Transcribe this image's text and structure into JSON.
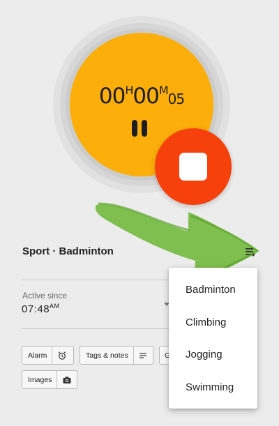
{
  "timer": {
    "hours": "00",
    "hours_unit": "H",
    "minutes": "00",
    "minutes_unit": "M",
    "seconds": "05"
  },
  "section": {
    "title": "Sport · Badminton"
  },
  "active": {
    "label": "Active since",
    "time": "07:48",
    "ampm": "AM"
  },
  "chips": {
    "alarm": "Alarm",
    "tags": "Tags & notes",
    "partial": "G",
    "images": "Images"
  },
  "menu": {
    "items": [
      "Badminton",
      "Climbing",
      "Jogging",
      "Swimming"
    ]
  },
  "colors": {
    "timer": "#fcaf0b",
    "stop": "#f7410d",
    "annotation": "#6fb83a"
  },
  "icons": {
    "pause": "pause-icon",
    "stop": "stop-icon",
    "playlist": "playlist-icon",
    "alarm": "alarm-icon",
    "notes": "notes-icon",
    "camera": "camera-icon",
    "dropdown": "caret-down-icon"
  }
}
